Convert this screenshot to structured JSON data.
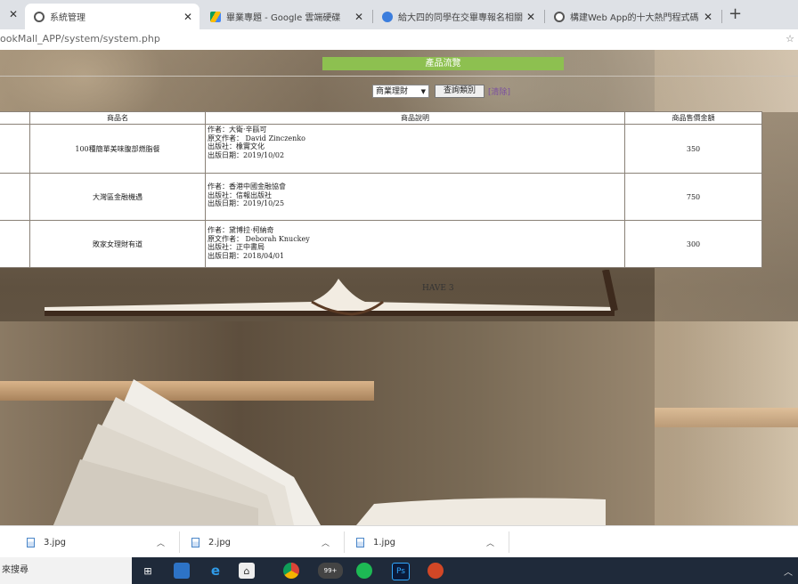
{
  "tabs": [
    {
      "title": "系統管理",
      "active": true,
      "favicon_color": "#555555"
    },
    {
      "title": "畢業專題 - Google 雲端硬碟",
      "active": false,
      "favicon_color": "#1a73e8"
    },
    {
      "title": "給大四的同學在交畢專報名相關",
      "active": false,
      "favicon_color": "#3b7ddd"
    },
    {
      "title": "構建Web App的十大熱門程式碼",
      "active": false,
      "favicon_color": "#555555"
    }
  ],
  "url": "ookMall_APP/system/system.php",
  "page": {
    "banner": "產品流覽",
    "category_select_value": "商業理財",
    "query_button": "查詢類別",
    "clear_link": "[清除]",
    "table": {
      "headers": [
        "商品名",
        "商品說明",
        "商品售價金額"
      ],
      "rows": [
        {
          "name": "100種簡單美味腹部燃脂餐",
          "desc": [
            "作者：大衛·辛甌可",
            "原文作者： David Zinczenko",
            "出版社：橡實文化",
            "出版日期：2019/10/02"
          ],
          "price": "350"
        },
        {
          "name": "大灣區金融機遇",
          "desc": [
            "作者：香港中國金融協會",
            "出版社：信報出版社",
            "出版日期：2019/10/25"
          ],
          "price": "750"
        },
        {
          "name": "敗家女理財有道",
          "desc": [
            "作者：黛博拉·柯納奇",
            "原文作者： Deborah Knuckey",
            "出版社：正中書局",
            "出版日期：2018/04/01"
          ],
          "price": "300"
        }
      ]
    },
    "count_text": "HAVE 3"
  },
  "downloads": [
    {
      "file": "3.jpg"
    },
    {
      "file": "2.jpg"
    },
    {
      "file": "1.jpg"
    }
  ],
  "taskbar": {
    "search_placeholder": "來搜尋",
    "badge": "99+"
  }
}
